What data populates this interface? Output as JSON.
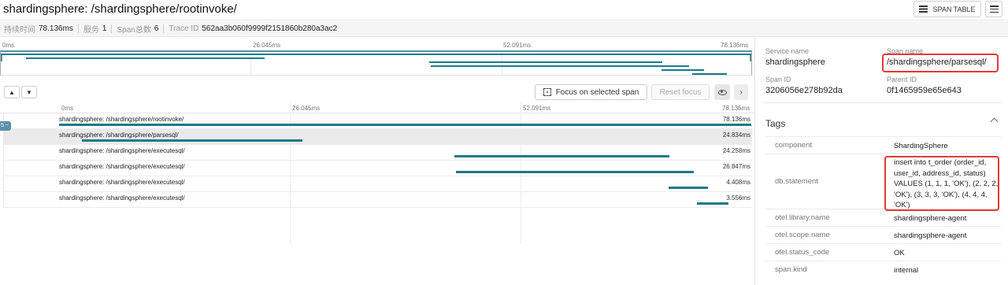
{
  "header": {
    "title": "shardingsphere: /shardingsphere/rootinvoke/",
    "span_table_label": "SPAN TABLE"
  },
  "summary": {
    "duration_label": "持续时间",
    "duration_value": "78.136ms",
    "services_label": "服务",
    "services_value": "1",
    "span_count_label": "Span总数",
    "span_count_value": "6",
    "trace_id_label": "Trace ID",
    "trace_id_value": "562aa3b060f9999f2151860b280a3ac2"
  },
  "timeline": {
    "ticks": [
      "0ms",
      "26.045ms",
      "52.091ms",
      "78.136ms"
    ],
    "total_ms": 78.136,
    "focus_label": "Focus on selected span",
    "reset_label": "Reset focus",
    "collapse_tab": "5 −"
  },
  "spans": [
    {
      "label": "shardingsphere: /shardingsphere/rootinvoke/",
      "duration": "78.136ms",
      "start_ms": 0.0,
      "dur_ms": 78.136,
      "selected": false
    },
    {
      "label": "shardingsphere: /shardingsphere/parsesql/",
      "duration": "24.834ms",
      "start_ms": 2.6,
      "dur_ms": 24.834,
      "selected": true
    },
    {
      "label": "shardingsphere: /shardingsphere/executesql/",
      "duration": "24.258ms",
      "start_ms": 44.6,
      "dur_ms": 24.258,
      "selected": false
    },
    {
      "label": "shardingsphere: /shardingsphere/executesql/",
      "duration": "26.847ms",
      "start_ms": 44.8,
      "dur_ms": 26.847,
      "selected": false
    },
    {
      "label": "shardingsphere: /shardingsphere/executesql/",
      "duration": "4.408ms",
      "start_ms": 68.8,
      "dur_ms": 4.408,
      "selected": false
    },
    {
      "label": "shardingsphere: /shardingsphere/executesql/",
      "duration": "3.556ms",
      "start_ms": 72.0,
      "dur_ms": 3.556,
      "selected": false
    }
  ],
  "detail": {
    "service_name_label": "Service name",
    "service_name": "shardingsphere",
    "span_name_label": "Span name",
    "span_name": "/shardingsphere/parsesql/",
    "span_id_label": "Span ID",
    "span_id": "3206056e278b92da",
    "parent_id_label": "Parent ID",
    "parent_id": "0f1465959e65e643",
    "tags_title": "Tags",
    "tags": [
      {
        "key": "component",
        "value": "ShardingSphere"
      },
      {
        "key": "db.statement",
        "value": "insert into t_order (order_id, user_id, address_id, status) VALUES (1, 1, 1, 'OK'), (2, 2, 2, 'OK'), (3, 3, 3, 'OK'), (4, 4, 4, 'OK')"
      },
      {
        "key": "otel.library.name",
        "value": "shardingsphere-agent"
      },
      {
        "key": "otel.scope.name",
        "value": "shardingsphere-agent"
      },
      {
        "key": "otel.status_code",
        "value": "OK"
      },
      {
        "key": "span.kind",
        "value": "internal"
      }
    ]
  },
  "colors": {
    "span_bar": "#1a7a8c",
    "highlight": "#e53935",
    "accent": "#5b8fa8"
  }
}
